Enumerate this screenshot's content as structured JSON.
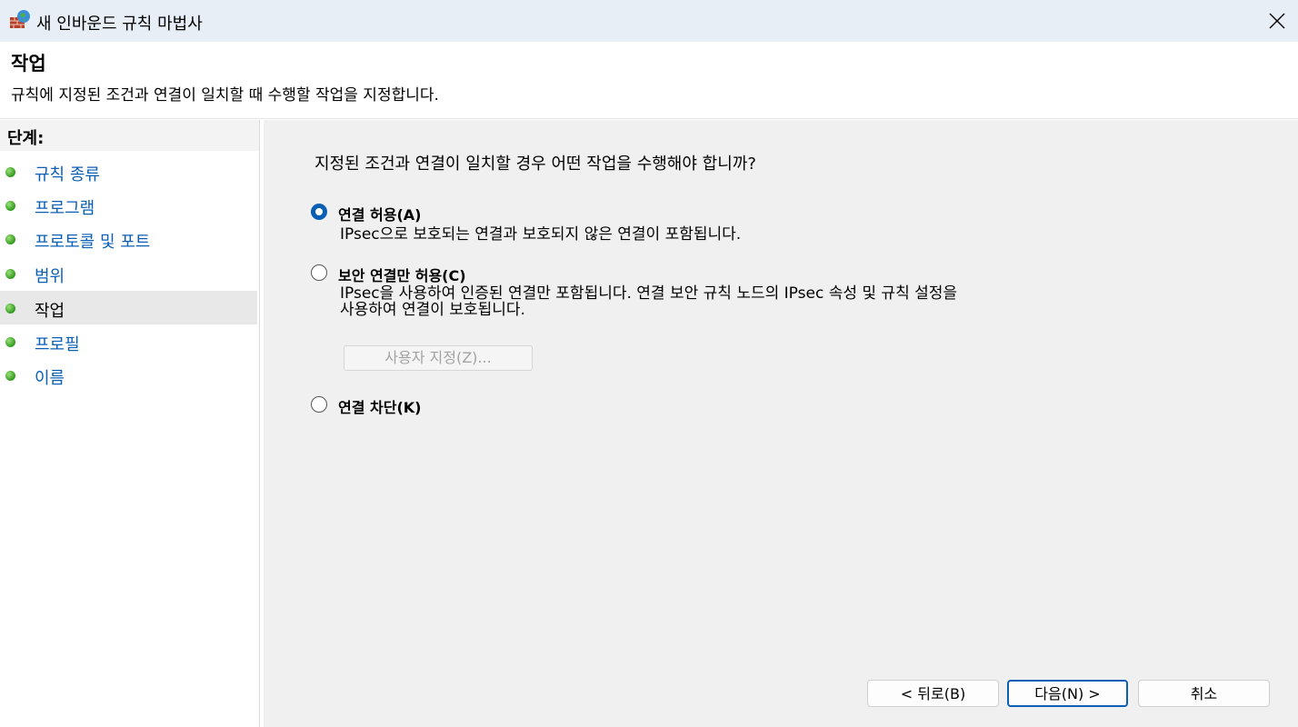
{
  "window": {
    "title": "새 인바운드 규칙 마법사",
    "icon": "firewall-globe-icon"
  },
  "header": {
    "title": "작업",
    "subtitle": "규칙에 지정된 조건과 연결이 일치할 때 수행할 작업을 지정합니다."
  },
  "steps": {
    "title": "단계:",
    "items": [
      {
        "label": "규칙 종류",
        "current": false
      },
      {
        "label": "프로그램",
        "current": false
      },
      {
        "label": "프로토콜 및 포트",
        "current": false
      },
      {
        "label": "범위",
        "current": false
      },
      {
        "label": "작업",
        "current": true
      },
      {
        "label": "프로필",
        "current": false
      },
      {
        "label": "이름",
        "current": false
      }
    ]
  },
  "main": {
    "question": "지정된 조건과 연결이 일치할 경우 어떤 작업을 수행해야 합니까?",
    "options": [
      {
        "label": "연결 허용(A)",
        "checked": true,
        "description": [
          "IPsec으로 보호되는 연결과 보호되지 않은 연결이 포함됩니다."
        ]
      },
      {
        "label": "보안 연결만 허용(C)",
        "checked": false,
        "description": [
          "IPsec을 사용하여 인증된 연결만 포함됩니다. 연결 보안 규칙 노드의 IPsec 속성 및 규칙 설정을",
          "사용하여 연결이 보호됩니다."
        ]
      },
      {
        "label": "연결 차단(K)",
        "checked": false,
        "description": []
      }
    ],
    "customize_label": "사용자 지정(Z)..."
  },
  "buttons": {
    "back": "< 뒤로(B)",
    "next": "다음(N) >",
    "cancel": "취소"
  },
  "colors": {
    "accent": "#0a5fb4",
    "titlebar": "#e8eef6",
    "content_bg": "#f0f0f0"
  }
}
